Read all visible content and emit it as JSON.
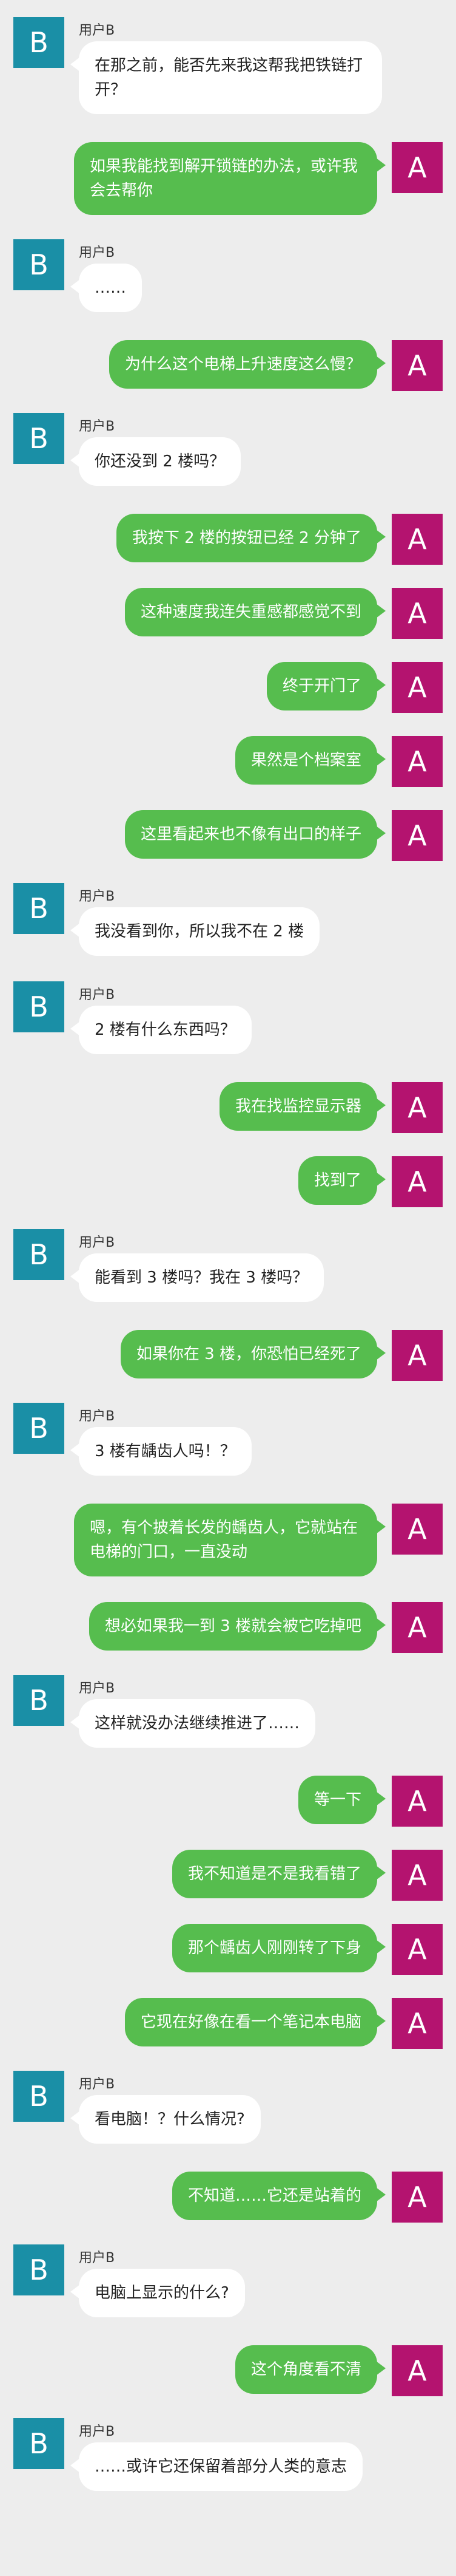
{
  "avatars": {
    "left_letter": "B",
    "right_letter": "A"
  },
  "messages": [
    {
      "side": "left",
      "name": "用户B",
      "text": "在那之前，能否先来我这帮我把铁链打开？"
    },
    {
      "side": "right",
      "text": "如果我能找到解开锁链的办法，或许我会去帮你"
    },
    {
      "side": "left",
      "name": "用户B",
      "text": "……"
    },
    {
      "side": "right",
      "text": "为什么这个电梯上升速度这么慢？"
    },
    {
      "side": "left",
      "name": "用户B",
      "text": "你还没到 2 楼吗？"
    },
    {
      "side": "right",
      "text": "我按下 2 楼的按钮已经 2 分钟了"
    },
    {
      "side": "right",
      "text": "这种速度我连失重感都感觉不到"
    },
    {
      "side": "right",
      "text": "终于开门了"
    },
    {
      "side": "right",
      "text": "果然是个档案室"
    },
    {
      "side": "right",
      "text": "这里看起来也不像有出口的样子"
    },
    {
      "side": "left",
      "name": "用户B",
      "text": "我没看到你，所以我不在 2 楼"
    },
    {
      "side": "left",
      "name": "用户B",
      "text": "2 楼有什么东西吗？"
    },
    {
      "side": "right",
      "text": "我在找监控显示器"
    },
    {
      "side": "right",
      "text": "找到了"
    },
    {
      "side": "left",
      "name": "用户B",
      "text": "能看到 3 楼吗？我在 3 楼吗？"
    },
    {
      "side": "right",
      "text": "如果你在 3 楼，你恐怕已经死了"
    },
    {
      "side": "left",
      "name": "用户B",
      "text": "3 楼有龋齿人吗！？"
    },
    {
      "side": "right",
      "text": "嗯，有个披着长发的龋齿人，它就站在电梯的门口，一直没动"
    },
    {
      "side": "right",
      "text": "想必如果我一到 3 楼就会被它吃掉吧"
    },
    {
      "side": "left",
      "name": "用户B",
      "text": "这样就没办法继续推进了……"
    },
    {
      "side": "right",
      "text": "等一下"
    },
    {
      "side": "right",
      "text": "我不知道是不是我看错了"
    },
    {
      "side": "right",
      "text": "那个龋齿人刚刚转了下身"
    },
    {
      "side": "right",
      "text": "它现在好像在看一个笔记本电脑"
    },
    {
      "side": "left",
      "name": "用户B",
      "text": "看电脑！？什么情况?"
    },
    {
      "side": "right",
      "text": "不知道……它还是站着的"
    },
    {
      "side": "left",
      "name": "用户B",
      "text": "电脑上显示的什么?"
    },
    {
      "side": "right",
      "text": "这个角度看不清"
    },
    {
      "side": "left",
      "name": "用户B",
      "text": "……或许它还保留着部分人类的意志"
    }
  ]
}
